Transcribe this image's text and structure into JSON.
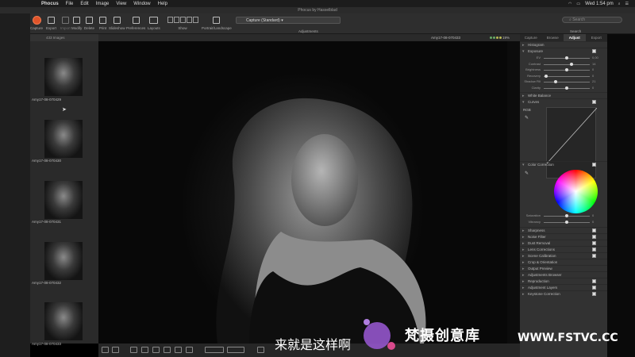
{
  "menubar": {
    "app_name": "Phocus",
    "menus": [
      "File",
      "Edit",
      "Image",
      "View",
      "Window",
      "Help"
    ],
    "clock": "Wed 1:54 pm"
  },
  "window": {
    "title": "Phocus by Hasselblad"
  },
  "toolbar": {
    "items": [
      {
        "label": "Capture"
      },
      {
        "label": "Export"
      },
      {
        "label": "Import"
      },
      {
        "label": "Modify"
      },
      {
        "label": "Delete"
      },
      {
        "label": "Print"
      },
      {
        "label": "Slideshow"
      },
      {
        "label": "Preferences"
      },
      {
        "label": "Layouts"
      }
    ],
    "show_label": "Show",
    "portrait_label": "Portrait/Landscape",
    "style_value": "Capture (Standard)",
    "adjustments_label": "Adjustments",
    "search_placeholder": "Search",
    "search_label": "Search"
  },
  "browser": {
    "count": "433 Images",
    "thumbnails": [
      {
        "name": "Amy17-08-070429"
      },
      {
        "name": "Amy17-08-070430"
      },
      {
        "name": "Amy17-08-070431"
      },
      {
        "name": "Amy17-08-070432"
      },
      {
        "name": "Amy17-08-070433"
      }
    ]
  },
  "viewer": {
    "image_name": "Amy17-08-070433",
    "zoom": "19%"
  },
  "panel": {
    "tabs": [
      "Capture",
      "Browse",
      "Adjust",
      "Export"
    ],
    "active_tab": "Adjust",
    "tools": {
      "histogram": "Histogram",
      "exposure": "Exposure",
      "white_balance": "White Balance",
      "curves": "Curves",
      "color_correction": "Color Correction",
      "rgb_label": "RGB",
      "lower": [
        "Sharpness",
        "Noise Filter",
        "Dust Removal",
        "Lens Corrections",
        "Scene Calibration",
        "Crop & Orientation",
        "Output Preview",
        "Adjustments Browser",
        "Reproduction",
        "Adjustment Layers",
        "Keystone Correction"
      ]
    },
    "exposure_sliders": [
      {
        "label": "EV",
        "value": "0,00",
        "level": 0.5
      },
      {
        "label": "Contrast",
        "value": "14",
        "level": 0.6
      },
      {
        "label": "Brightness",
        "value": "0",
        "level": 0.5
      },
      {
        "label": "Recovery",
        "value": "0",
        "level": 0.05
      },
      {
        "label": "Shadow Fill",
        "value": "21",
        "level": 0.25
      },
      {
        "label": "Clarity",
        "value": "0",
        "level": 0.5
      }
    ],
    "color_sliders": [
      {
        "label": "Saturation",
        "value": "0",
        "level": 0.5
      },
      {
        "label": "Vibrancy",
        "value": "0",
        "level": 0.5
      }
    ]
  },
  "overlay": {
    "subtitle": "来就是这样啊",
    "watermark_name": "梵摄创意库",
    "watermark_url": "WWW.FSTVC.CC"
  },
  "colors": {
    "capture_button": "#e0542a",
    "panel_bg": "#323232",
    "accent_logo": "#9b59d6"
  }
}
